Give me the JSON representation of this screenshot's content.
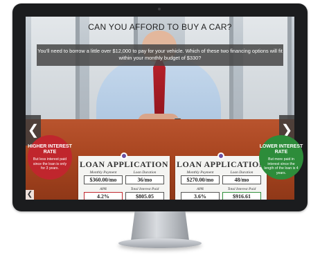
{
  "slide": {
    "title": "CAN YOU AFFORD TO BUY A CAR?",
    "question": "You'll need to borrow a little over $12,000 to pay for your vehicle. Which of these two financing options will fit within your monthly budget of $330?"
  },
  "nav": {
    "prev_glyph": "❮",
    "next_glyph": "❯",
    "small_prev_glyph": "❮"
  },
  "applications": [
    {
      "title": "LOAN APPLICATION",
      "monthly_payment_label": "Monthly Payment",
      "monthly_payment": "$360.00/mo",
      "loan_duration_label": "Loan Duration",
      "loan_duration": "36/mo",
      "apr_label": "APR",
      "apr": "4.2%",
      "total_interest_label": "Total Interest Paid",
      "total_interest": "$805.05"
    },
    {
      "title": "LOAN APPLICATION",
      "monthly_payment_label": "Monthly Payment",
      "monthly_payment": "$270.00/mo",
      "loan_duration_label": "Loan Duration",
      "loan_duration": "48/mo",
      "apr_label": "APR",
      "apr": "3.6%",
      "total_interest_label": "Total Interest Paid",
      "total_interest": "$916.61"
    }
  ],
  "badges": {
    "left": {
      "title": "HIGHER INTEREST RATE",
      "body": "But less interest paid since the loan is only for 3 years.",
      "color": "#c0262d"
    },
    "right": {
      "title": "LOWER INTEREST RATE",
      "body": "But more paid in interest since the length of the loan is 4 years.",
      "color": "#2d8c3a"
    }
  }
}
